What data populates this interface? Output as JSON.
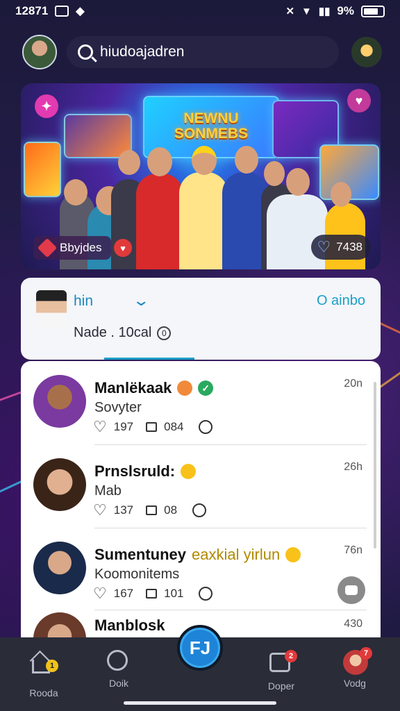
{
  "status_bar": {
    "time": "12871",
    "battery": "9%"
  },
  "header": {
    "search_text": "hiudoajadren"
  },
  "banner": {
    "title": "NEWNU SONMEBS",
    "chip_label": "Bbyjdes",
    "likes": "7438"
  },
  "filter": {
    "name": "hin",
    "right_link": "O ainbo",
    "subtitle": "Nade . 10cal"
  },
  "feed": {
    "items": [
      {
        "name": "Manlëkaak",
        "subtitle": "Sovyter",
        "likes": "197",
        "comments": "084",
        "time": "20n"
      },
      {
        "name": "Prnslsruld:",
        "subtitle": "Mab",
        "likes": "137",
        "comments": "08",
        "time": "26h"
      },
      {
        "name": "Sumentuney",
        "name_accent": "eaxkial yirlun",
        "subtitle": "Koomonitems",
        "likes": "167",
        "comments": "101",
        "time": "76n"
      },
      {
        "name": "Manblosk",
        "time": "430"
      }
    ]
  },
  "bottom_nav": {
    "items": [
      {
        "label": "Rooda",
        "badge": "1",
        "badge_color": "#f0c21a"
      },
      {
        "label": "Doik"
      },
      {
        "label": "Doper",
        "badge": "2",
        "badge_color": "#e23a3a"
      },
      {
        "label": "Vodg",
        "badge": "7",
        "badge_color": "#e23a3a"
      }
    ],
    "center_label": "FJ"
  }
}
